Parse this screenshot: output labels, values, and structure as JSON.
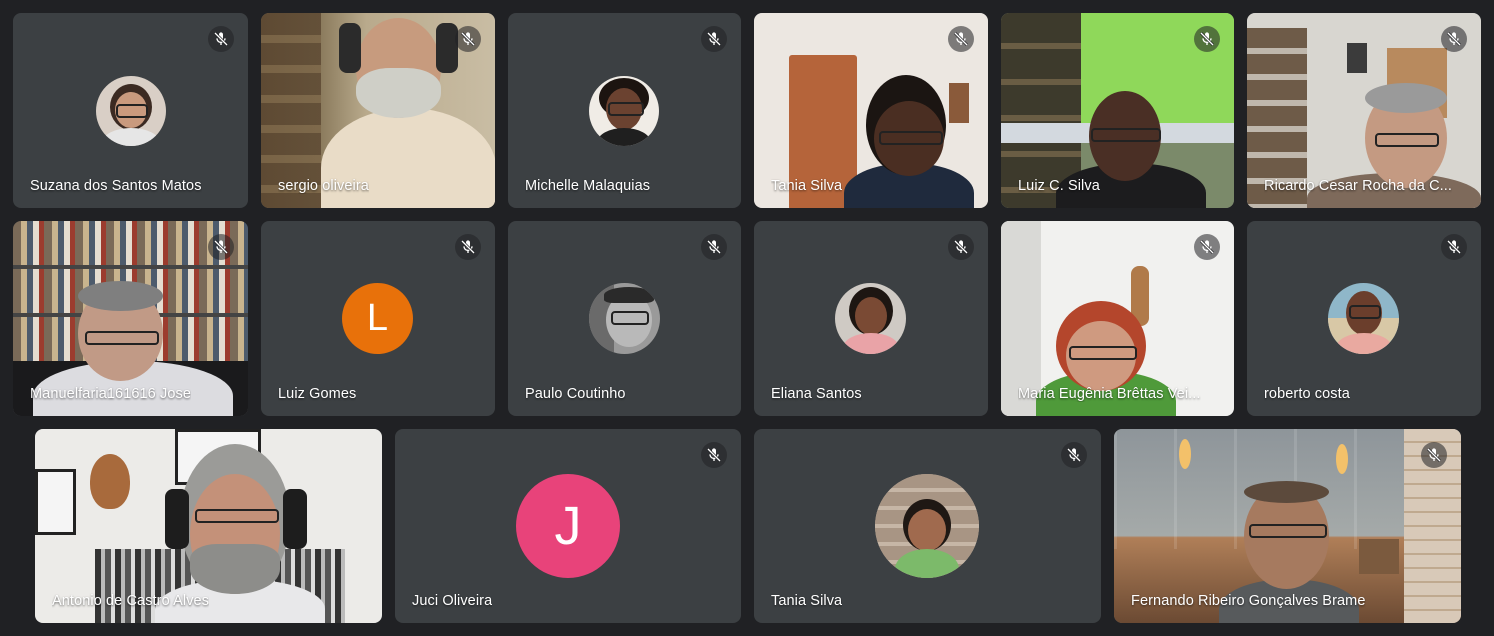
{
  "participants": [
    {
      "name": "Suzana dos Santos Matos",
      "muted": true,
      "type": "avatar-photo"
    },
    {
      "name": "sergio oliveira",
      "muted": true,
      "type": "video"
    },
    {
      "name": "Michelle Malaquias",
      "muted": true,
      "type": "avatar-photo"
    },
    {
      "name": "Tania Silva",
      "muted": true,
      "type": "video"
    },
    {
      "name": "Luiz C. Silva",
      "muted": true,
      "type": "video"
    },
    {
      "name": "Ricardo Cesar Rocha da C...",
      "muted": true,
      "type": "video"
    },
    {
      "name": "Manuelfaria161616 Jose",
      "muted": true,
      "type": "video"
    },
    {
      "name": "Luiz Gomes",
      "muted": true,
      "type": "avatar-letter",
      "initial": "L",
      "color": "#e8710a"
    },
    {
      "name": "Paulo Coutinho",
      "muted": true,
      "type": "avatar-photo"
    },
    {
      "name": "Eliana Santos",
      "muted": true,
      "type": "avatar-photo"
    },
    {
      "name": "Maria Eugênia Brêttas Vei...",
      "muted": true,
      "type": "video"
    },
    {
      "name": "roberto costa",
      "muted": true,
      "type": "avatar-photo"
    },
    {
      "name": "Antonio de Castro Alves",
      "muted": false,
      "type": "video"
    },
    {
      "name": "Juci Oliveira",
      "muted": true,
      "type": "avatar-letter",
      "initial": "J",
      "color": "#e8437a"
    },
    {
      "name": "Tania Silva",
      "muted": true,
      "type": "avatar-photo"
    },
    {
      "name": "Fernando Ribeiro Gonçalves Brame",
      "muted": true,
      "type": "video"
    }
  ],
  "colors": {
    "background": "#202124",
    "tile": "#3c4043"
  },
  "icons": {
    "mute": "mic-off-icon"
  }
}
